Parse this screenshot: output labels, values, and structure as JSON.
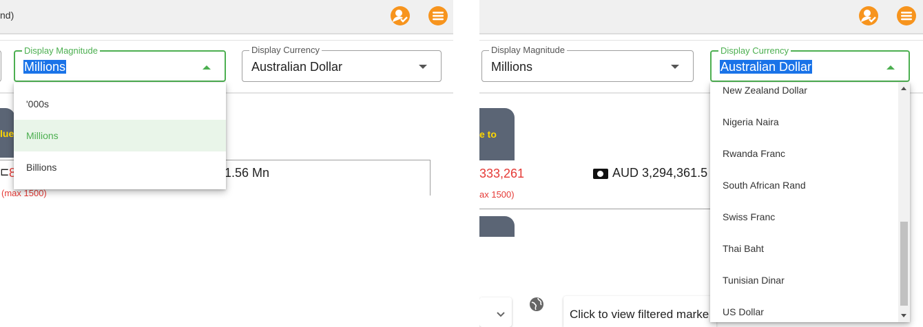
{
  "left": {
    "header": {
      "title_fragment": "nd)"
    },
    "magnitude": {
      "label": "Display Magnitude",
      "value": "Millions"
    },
    "currency": {
      "label": "Display Currency",
      "value": "Australian Dollar"
    },
    "magnitude_options": [
      "'000s",
      "Millions",
      "Billions"
    ],
    "tab_text": "lue",
    "red_value": "8",
    "amount_text": "1.56 Mn",
    "limit_note": "(max 1500)"
  },
  "right": {
    "magnitude": {
      "label": "Display Magnitude",
      "value": "Millions"
    },
    "currency": {
      "label": "Display Currency",
      "value": "Australian Dollar"
    },
    "currency_options": [
      "New Zealand Dollar",
      "Nigeria Naira",
      "Rwanda Franc",
      "South African Rand",
      "Swiss Franc",
      "Thai Baht",
      "Tunisian Dinar",
      "US Dollar"
    ],
    "tab_text": "e to",
    "red_value": "333,261",
    "amount_text": "AUD 3,294,361.5",
    "limit_note": "ax 1500)",
    "market_button": "Click to view filtered marke"
  },
  "icons": {
    "user": "user-check-icon",
    "menu": "hamburger-menu-icon",
    "cash": "cash-icon",
    "globe": "globe-icon",
    "chevron": "chevron-down-icon"
  },
  "colors": {
    "accent_orange": "#f7941d",
    "focus_green": "#4caf50",
    "tab_slate": "#5b6575",
    "tab_text_yellow": "#ffd700",
    "value_red": "#e53935",
    "selection_blue": "#1a73e8"
  }
}
